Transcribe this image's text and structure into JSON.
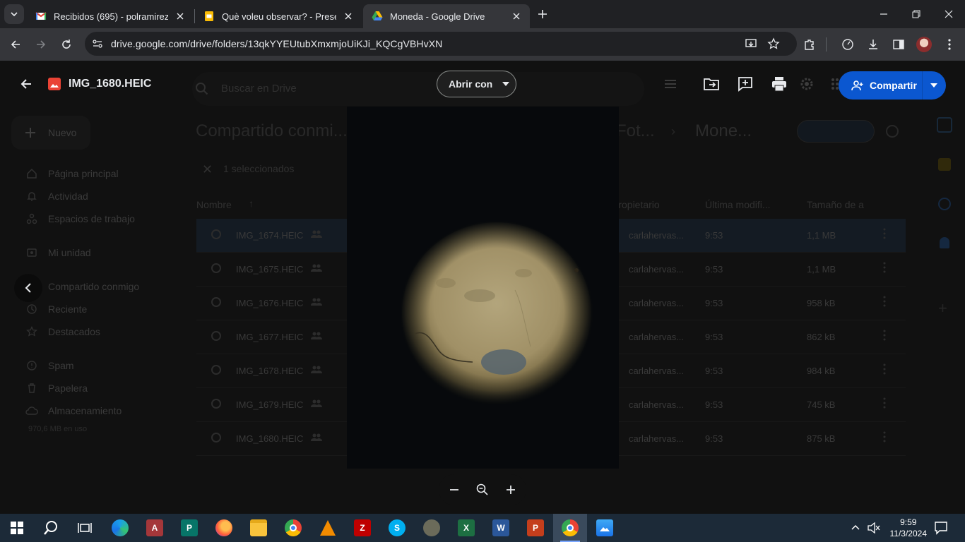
{
  "browser": {
    "tabs": [
      {
        "label": "Recibidos (695) - polramirez@e",
        "active": false
      },
      {
        "label": "Què voleu observar? - Presentac",
        "active": false
      },
      {
        "label": "Moneda - Google Drive",
        "active": true
      }
    ],
    "url": "drive.google.com/drive/folders/13qkYYEUtubXmxmjoUiKJi_KQCgVBHvXN"
  },
  "drive": {
    "search_placeholder": "Buscar en Drive",
    "new_label": "Nuevo",
    "nav": [
      {
        "label": "Página principal",
        "icon": "home-icon"
      },
      {
        "label": "Actividad",
        "icon": "bell-icon"
      },
      {
        "label": "Espacios de trabajo",
        "icon": "workspaces-icon"
      },
      {
        "label": "Mi unidad",
        "icon": "drive-icon"
      },
      {
        "label": "Compartido conmigo",
        "icon": "people-icon"
      },
      {
        "label": "Reciente",
        "icon": "clock-icon"
      },
      {
        "label": "Destacados",
        "icon": "star-icon"
      },
      {
        "label": "Spam",
        "icon": "spam-icon"
      },
      {
        "label": "Papelera",
        "icon": "trash-icon"
      },
      {
        "label": "Almacenamiento",
        "icon": "cloud-icon"
      }
    ],
    "storage_used": "970,6 MB en uso",
    "breadcrumb_root": "Compartido conmi...",
    "breadcrumb_mid": "Fot...",
    "breadcrumb_current": "Mone...",
    "selection_label": "1 seleccionados",
    "columns": {
      "name": "Nombre",
      "owner": "Propietario",
      "modified": "Última modifi...",
      "size": "Tamaño de a"
    },
    "files": [
      {
        "name": "IMG_1674.HEIC",
        "owner": "carlahervas...",
        "modified": "9:53",
        "size": "1,1 MB"
      },
      {
        "name": "IMG_1675.HEIC",
        "owner": "carlahervas...",
        "modified": "9:53",
        "size": "1,1 MB"
      },
      {
        "name": "IMG_1676.HEIC",
        "owner": "carlahervas...",
        "modified": "9:53",
        "size": "958 kB"
      },
      {
        "name": "IMG_1677.HEIC",
        "owner": "carlahervas...",
        "modified": "9:53",
        "size": "862 kB"
      },
      {
        "name": "IMG_1678.HEIC",
        "owner": "carlahervas...",
        "modified": "9:53",
        "size": "984 kB"
      },
      {
        "name": "IMG_1679.HEIC",
        "owner": "carlahervas...",
        "modified": "9:53",
        "size": "745 kB"
      },
      {
        "name": "IMG_1680.HEIC",
        "owner": "carlahervas...",
        "modified": "9:53",
        "size": "875 kB"
      }
    ]
  },
  "viewer": {
    "file_title": "IMG_1680.HEIC",
    "open_with": "Abrir con",
    "share": "Compartir"
  },
  "taskbar": {
    "time": "9:59",
    "date": "11/3/2024",
    "apps": [
      "windows-start",
      "search",
      "task-view",
      "edge",
      "access",
      "publisher",
      "firefox",
      "file-explorer",
      "chrome",
      "vlc",
      "filezilla",
      "skype",
      "game",
      "excel",
      "word",
      "powerpoint",
      "chrome-profile",
      "photos"
    ]
  },
  "colors": {
    "accent": "#0b57d0",
    "chrome_bg": "#202124",
    "toolbar_bg": "#35363a"
  }
}
